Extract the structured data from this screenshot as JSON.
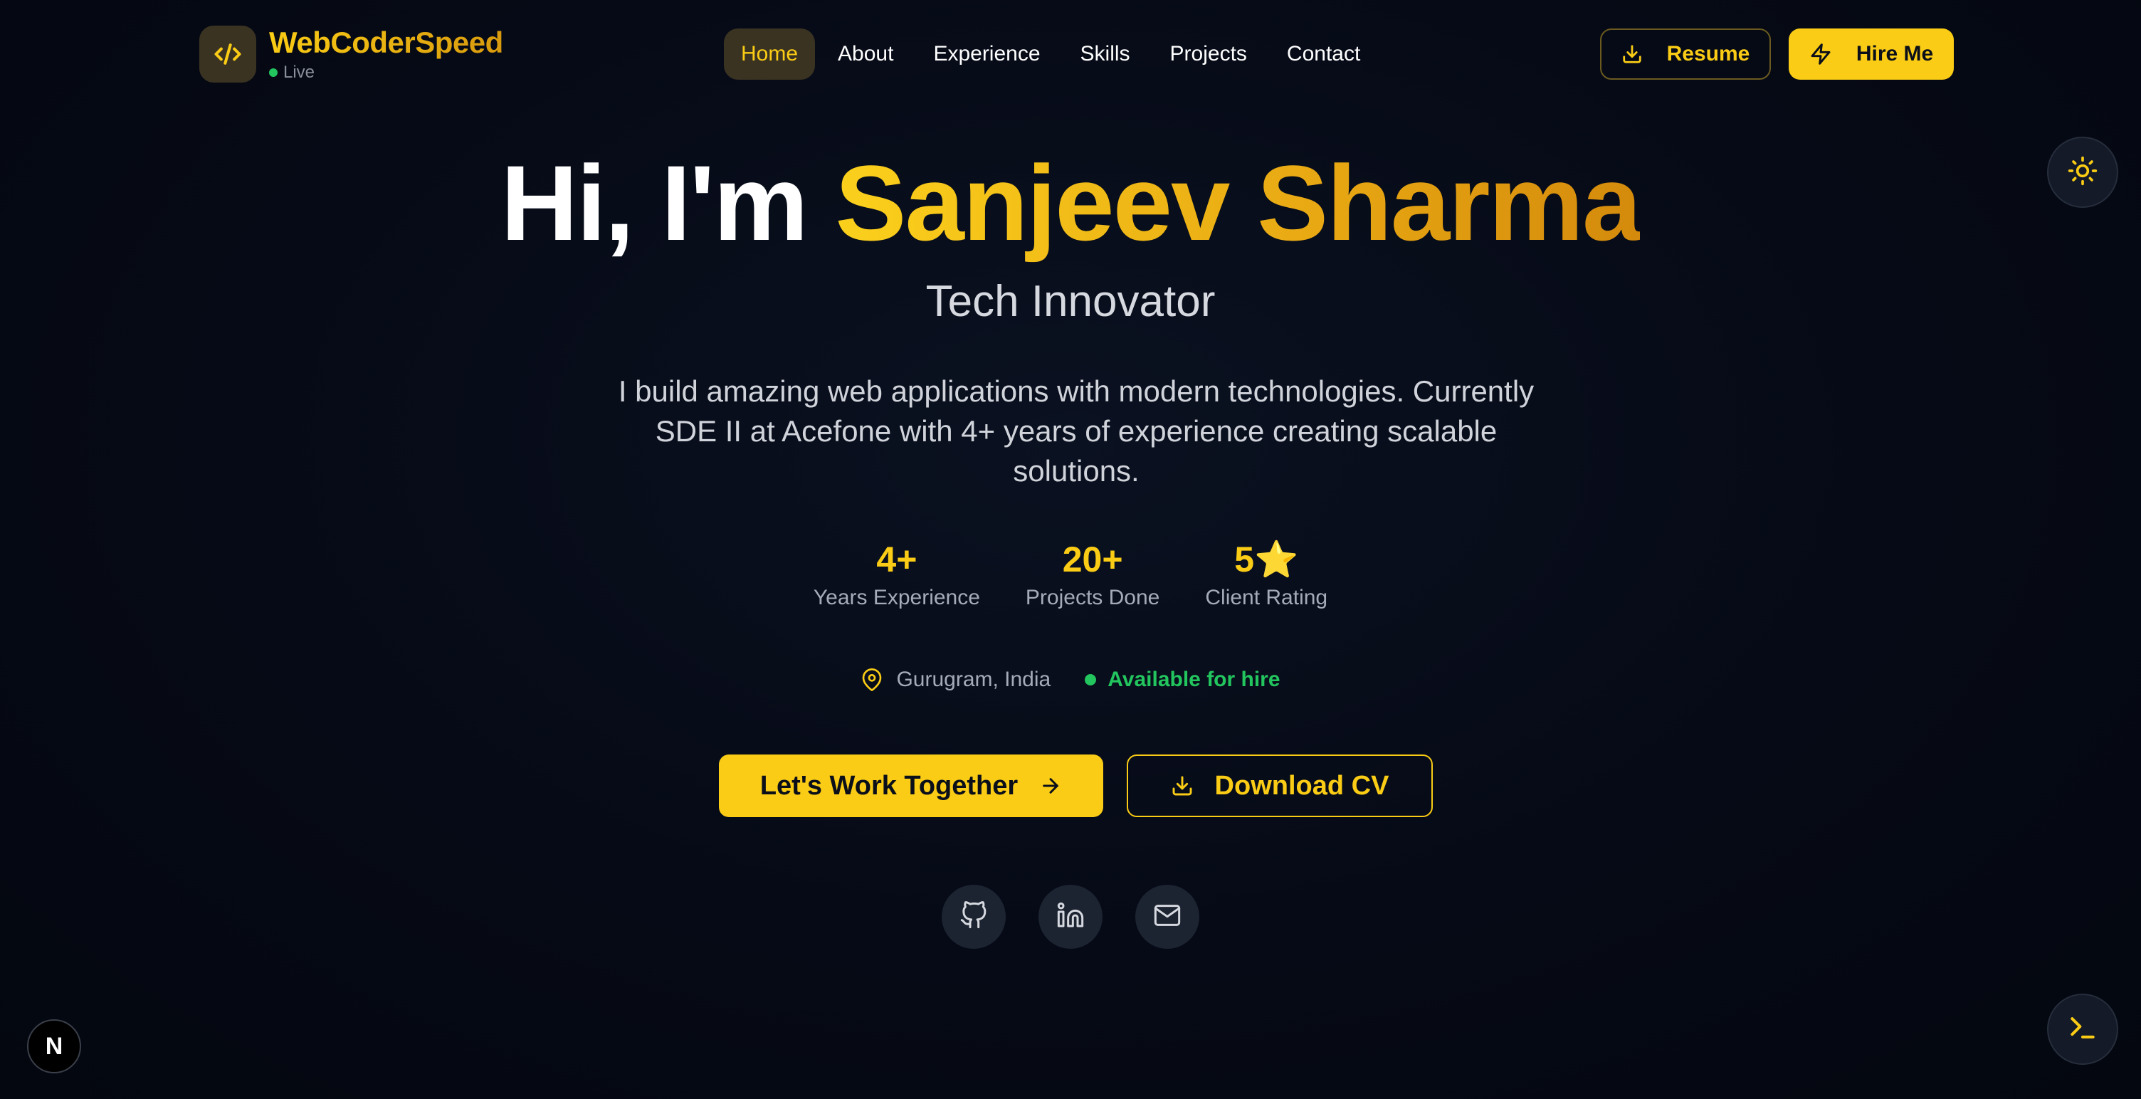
{
  "brand": {
    "name": "WebCoderSpeed",
    "status": "Live"
  },
  "nav": {
    "items": [
      {
        "label": "Home",
        "active": true
      },
      {
        "label": "About"
      },
      {
        "label": "Experience"
      },
      {
        "label": "Skills"
      },
      {
        "label": "Projects"
      },
      {
        "label": "Contact"
      }
    ]
  },
  "header_actions": {
    "resume_label": "Resume",
    "hire_label": "Hire Me"
  },
  "hero": {
    "greeting": "Hi, I'm ",
    "name": "Sanjeev Sharma",
    "role": "Tech Innovator",
    "description": "I build amazing web applications with modern technologies. Currently SDE II at Acefone with 4+ years of experience creating scalable solutions."
  },
  "stats": [
    {
      "value": "4+",
      "label": "Years Experience"
    },
    {
      "value": "20+",
      "label": "Projects Done"
    },
    {
      "value": "5⭐",
      "label": "Client Rating"
    }
  ],
  "location": {
    "text": "Gurugram, India",
    "availability": "Available for hire"
  },
  "cta": {
    "primary_label": "Let's Work Together",
    "secondary_label": "Download CV"
  },
  "socials": [
    {
      "icon": "github-icon"
    },
    {
      "icon": "linkedin-icon"
    },
    {
      "icon": "mail-icon"
    }
  ],
  "colors": {
    "accent": "#facc15",
    "background": "#050914",
    "available": "#22c55e"
  },
  "corner_badge": {
    "label": "N"
  }
}
